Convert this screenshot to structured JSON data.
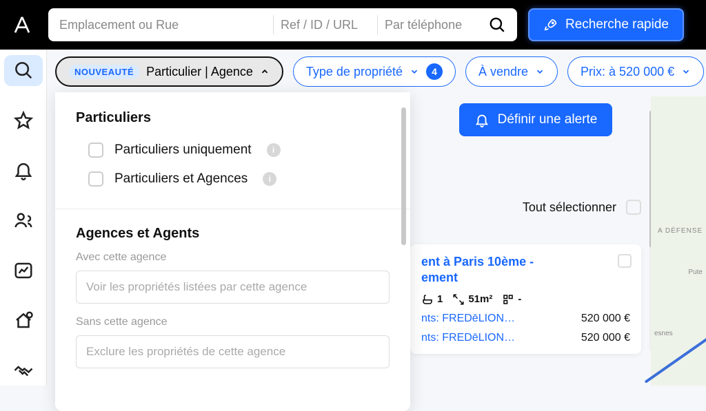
{
  "topbar": {
    "search_placeholder_location": "Emplacement ou Rue",
    "search_placeholder_ref": "Ref / ID / URL",
    "search_placeholder_phone": "Par téléphone",
    "quick_search_label": "Recherche rapide"
  },
  "filters": {
    "new_badge": "NOUVEAUTÉ",
    "seller_label": "Particulier | Agence",
    "property_type_label": "Type de propriété",
    "property_type_count": "4",
    "transaction_label": "À vendre",
    "price_label": "Prix: à 520 000 €"
  },
  "dropdown": {
    "section1_title": "Particuliers",
    "option1": "Particuliers uniquement",
    "option2": "Particuliers et Agences",
    "section2_title": "Agences et Agents",
    "with_label": "Avec cette agence",
    "with_placeholder": "Voir les propriétés listées par cette agence",
    "without_label": "Sans cette agence",
    "without_placeholder": "Exclure les propriétés de cette agence"
  },
  "alert_label": "Définir une alerte",
  "select_all_label": "Tout sélectionner",
  "card": {
    "title_part1": "ent à Paris 10ème -",
    "title_part2": "ement",
    "bath": "1",
    "area": "51m²",
    "rooms": "-",
    "listing1_agent": "nts: FREDēLION…",
    "listing1_price": "520 000 €",
    "listing2_agent": "nts: FREDēLION…",
    "listing2_price": "520 000 €"
  },
  "map": {
    "label_defense": "A DÉFENSE",
    "label_puteaux": "Pute",
    "label_suresnes": "esnes"
  }
}
